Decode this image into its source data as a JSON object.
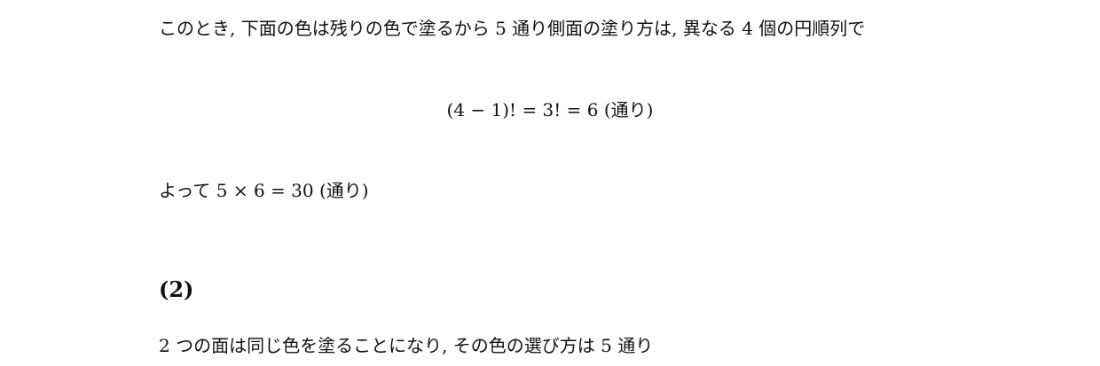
{
  "document": {
    "line_1": "このとき, 下面の色は残りの色で塗るから 5 通り側面の塗り方は, 異なる 4 個の円順列で",
    "display_equation": "(4 − 1)! = 3! = 6 (通り)",
    "line_2": "よって 5 × 6 = 30 (通り)",
    "section_heading": "(2)",
    "line_3": "2 つの面は同じ色を塗ることになり, その色の選び方は 5 通り"
  }
}
